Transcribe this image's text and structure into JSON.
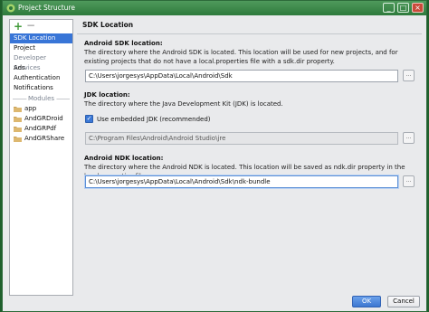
{
  "window": {
    "title": "Project Structure"
  },
  "sidebar": {
    "toolbar": {
      "add": "+",
      "remove": "−"
    },
    "items": [
      {
        "label": "SDK Location",
        "selected": true
      },
      {
        "label": "Project",
        "selected": false
      }
    ],
    "section_label": "Developer Services",
    "service_items": [
      "Ads",
      "Authentication",
      "Notifications"
    ],
    "modules_label": "Modules",
    "modules": [
      "app",
      "AndGRDroid",
      "AndGRPdf",
      "AndGRShare"
    ]
  },
  "content": {
    "section_title": "SDK Location",
    "android_sdk": {
      "title": "Android SDK location:",
      "description": "The directory where the Android SDK is located. This location will be used for new projects, and for existing projects that do not have a local.properties file with a sdk.dir property.",
      "path": "C:\\Users\\jorgesys\\AppData\\Local\\Android\\Sdk"
    },
    "jdk": {
      "title": "JDK location:",
      "description": "The directory where the Java Development Kit (JDK) is located.",
      "checkbox_label": "Use embedded JDK (recommended)",
      "checked": true,
      "path": "C:\\Program Files\\Android\\Android Studio\\jre"
    },
    "android_ndk": {
      "title": "Android NDK location:",
      "description": "The directory where the Android NDK is located. This location will be saved as ndk.dir property in the local.properties file.",
      "path": "C:\\Users\\jorgesys\\AppData\\Local\\Android\\Sdk\\ndk-bundle"
    },
    "browse_label": "..."
  },
  "footer": {
    "ok": "OK",
    "cancel": "Cancel"
  },
  "colors": {
    "selection": "#3875d7",
    "titlebar": "#3d8a4a",
    "folder": "#c9a15a"
  }
}
